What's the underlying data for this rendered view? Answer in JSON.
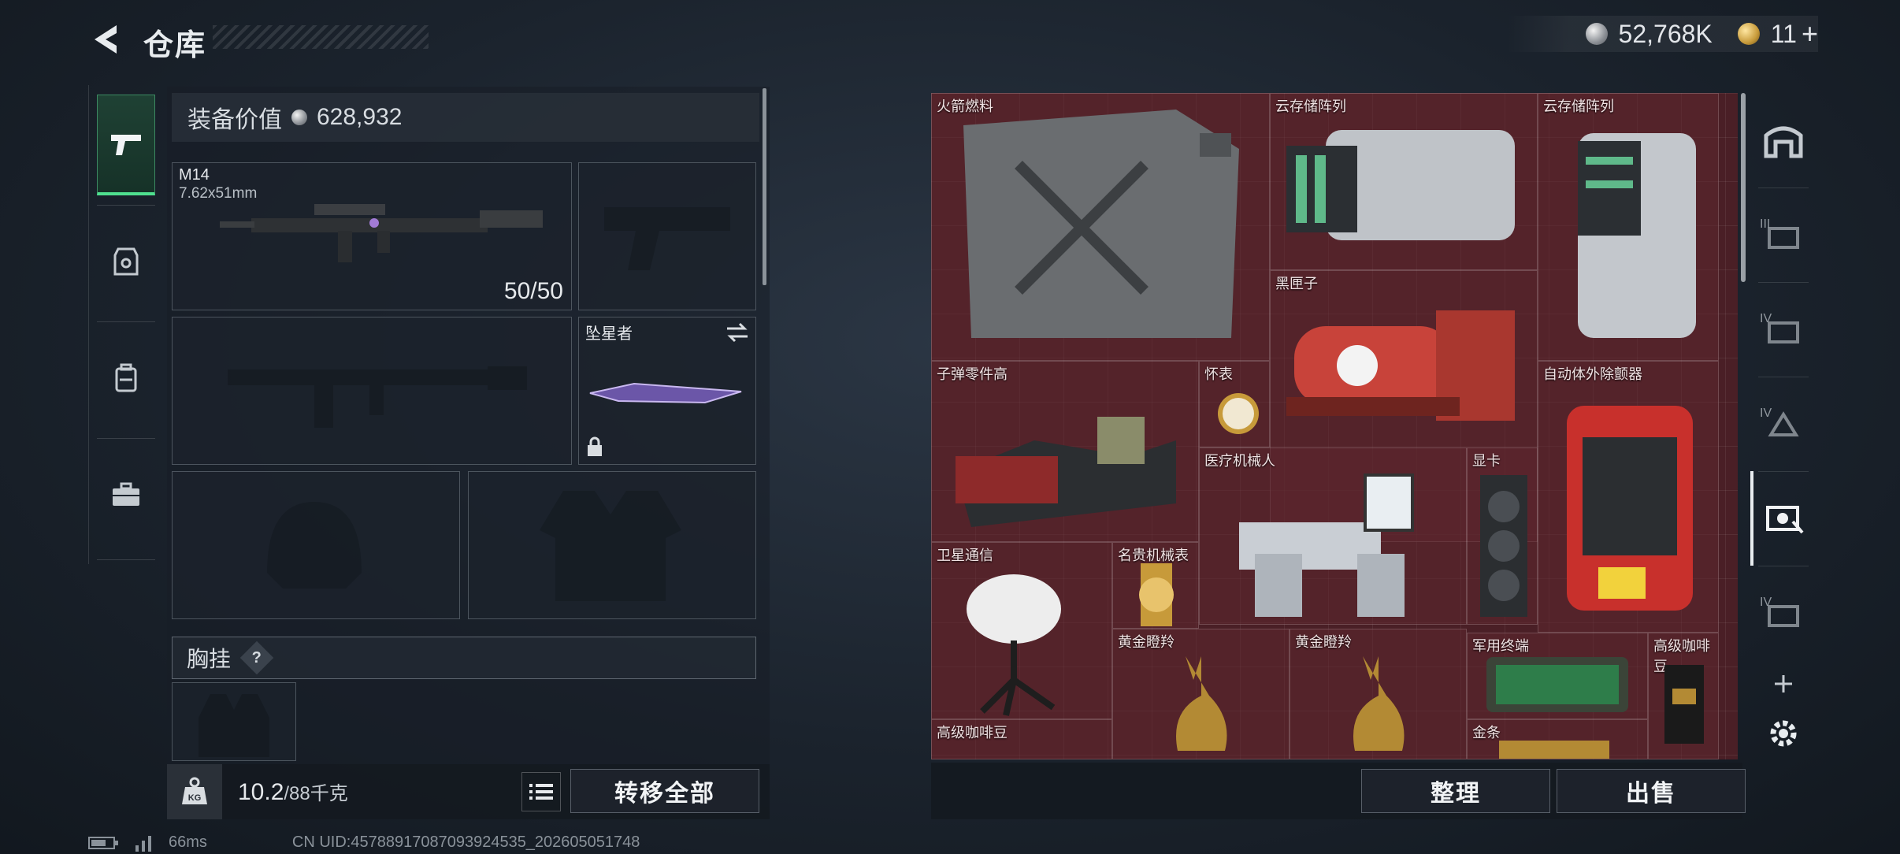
{
  "header": {
    "title": "仓库"
  },
  "currency": {
    "silver": "52,768K",
    "gold": "11",
    "gold_plus": "+"
  },
  "equipment": {
    "value_label": "装备价值",
    "value": "628,932",
    "primary": {
      "name": "M14",
      "caliber": "7.62x51mm",
      "ammo": "50/50"
    },
    "melee": {
      "name": "坠星者"
    },
    "chest_rig": {
      "label": "胸挂",
      "help": "?"
    }
  },
  "footer_left": {
    "weight": "10.2",
    "weight_cap": "/88千克",
    "kg_label": "KG",
    "transfer_all": "转移全部"
  },
  "footer_right": {
    "organize": "整理",
    "sell": "出售"
  },
  "stash_items": [
    {
      "label": "火箭燃料"
    },
    {
      "label": "云存储阵列"
    },
    {
      "label": "云存储阵列"
    },
    {
      "label": "黑匣子"
    },
    {
      "label": "子弹零件高"
    },
    {
      "label": "怀表"
    },
    {
      "label": "自动体外除颤器"
    },
    {
      "label": "医疗机械人"
    },
    {
      "label": "显卡"
    },
    {
      "label": "卫星通信"
    },
    {
      "label": "名贵机械表"
    },
    {
      "label": "黄金瞪羚"
    },
    {
      "label": "黄金瞪羚"
    },
    {
      "label": "军用终端"
    },
    {
      "label": "高级咖啡豆"
    },
    {
      "label": "高级咖啡豆"
    },
    {
      "label": "金条"
    }
  ],
  "side_tiers": [
    "III",
    "IV",
    "IV",
    "IV"
  ],
  "status": {
    "ping": "66ms",
    "uid": "CN UID:4578891708709392453​5_202605051748"
  }
}
